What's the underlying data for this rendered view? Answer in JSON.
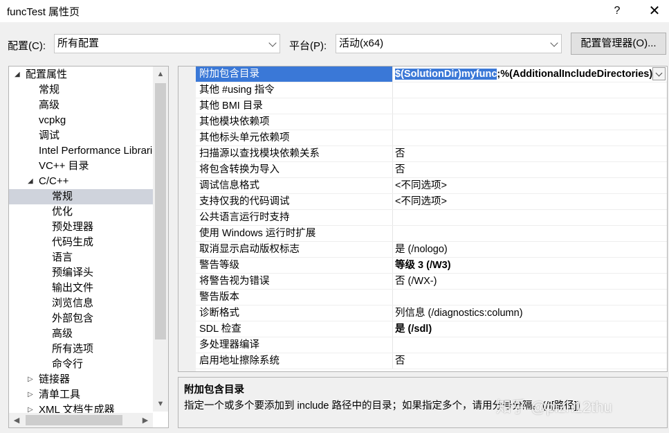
{
  "window": {
    "title": "funcTest 属性页",
    "help": "?",
    "close": "✕"
  },
  "toolbar": {
    "config_label": "配置(C):",
    "config_value": "所有配置",
    "platform_label": "平台(P):",
    "platform_value": "活动(x64)",
    "manager_button": "配置管理器(O)..."
  },
  "tree": {
    "items": [
      {
        "label": "配置属性",
        "expanded": true
      },
      {
        "label": "常规"
      },
      {
        "label": "高级"
      },
      {
        "label": "vcpkg"
      },
      {
        "label": "调试"
      },
      {
        "label": "Intel Performance Libraries"
      },
      {
        "label": "VC++ 目录"
      },
      {
        "label": "C/C++",
        "expanded": true
      },
      {
        "label": "常规",
        "selected": true
      },
      {
        "label": "优化"
      },
      {
        "label": "预处理器"
      },
      {
        "label": "代码生成"
      },
      {
        "label": "语言"
      },
      {
        "label": "预编译头"
      },
      {
        "label": "输出文件"
      },
      {
        "label": "浏览信息"
      },
      {
        "label": "外部包含"
      },
      {
        "label": "高级"
      },
      {
        "label": "所有选项"
      },
      {
        "label": "命令行"
      },
      {
        "label": "链接器",
        "expanded": false
      },
      {
        "label": "清单工具",
        "expanded": false
      },
      {
        "label": "XML 文档生成器",
        "expanded": false
      }
    ]
  },
  "grid": {
    "rows": [
      {
        "name": "附加包含目录",
        "value_sel": "$(SolutionDir)myfunc",
        "value": ";%(AdditionalIncludeDirectories)",
        "selected": true
      },
      {
        "name": "其他 #using 指令",
        "value": ""
      },
      {
        "name": "其他 BMI 目录",
        "value": ""
      },
      {
        "name": "其他模块依赖项",
        "value": ""
      },
      {
        "name": "其他标头单元依赖项",
        "value": ""
      },
      {
        "name": "扫描源以查找模块依赖关系",
        "value": "否"
      },
      {
        "name": "将包含转换为导入",
        "value": "否"
      },
      {
        "name": "调试信息格式",
        "value": "<不同选项>"
      },
      {
        "name": "支持仅我的代码调试",
        "value": "<不同选项>"
      },
      {
        "name": "公共语言运行时支持",
        "value": ""
      },
      {
        "name": "使用 Windows 运行时扩展",
        "value": ""
      },
      {
        "name": "取消显示启动版权标志",
        "value": "是 (/nologo)"
      },
      {
        "name": "警告等级",
        "value": "等级 3 (/W3)",
        "bold": true
      },
      {
        "name": "将警告视为错误",
        "value": "否 (/WX-)"
      },
      {
        "name": "警告版本",
        "value": ""
      },
      {
        "name": "诊断格式",
        "value": "列信息 (/diagnostics:column)"
      },
      {
        "name": "SDL 检查",
        "value": "是 (/sdl)",
        "bold": true
      },
      {
        "name": "多处理器编译",
        "value": ""
      },
      {
        "name": "启用地址擦除系统",
        "value": "否"
      }
    ]
  },
  "description": {
    "title": "附加包含目录",
    "text": "指定一个或多个要添加到 include 路径中的目录；如果指定多个，请用分号分隔。(/I[路径])",
    "watermark": "知乎 @pizh12thu"
  }
}
